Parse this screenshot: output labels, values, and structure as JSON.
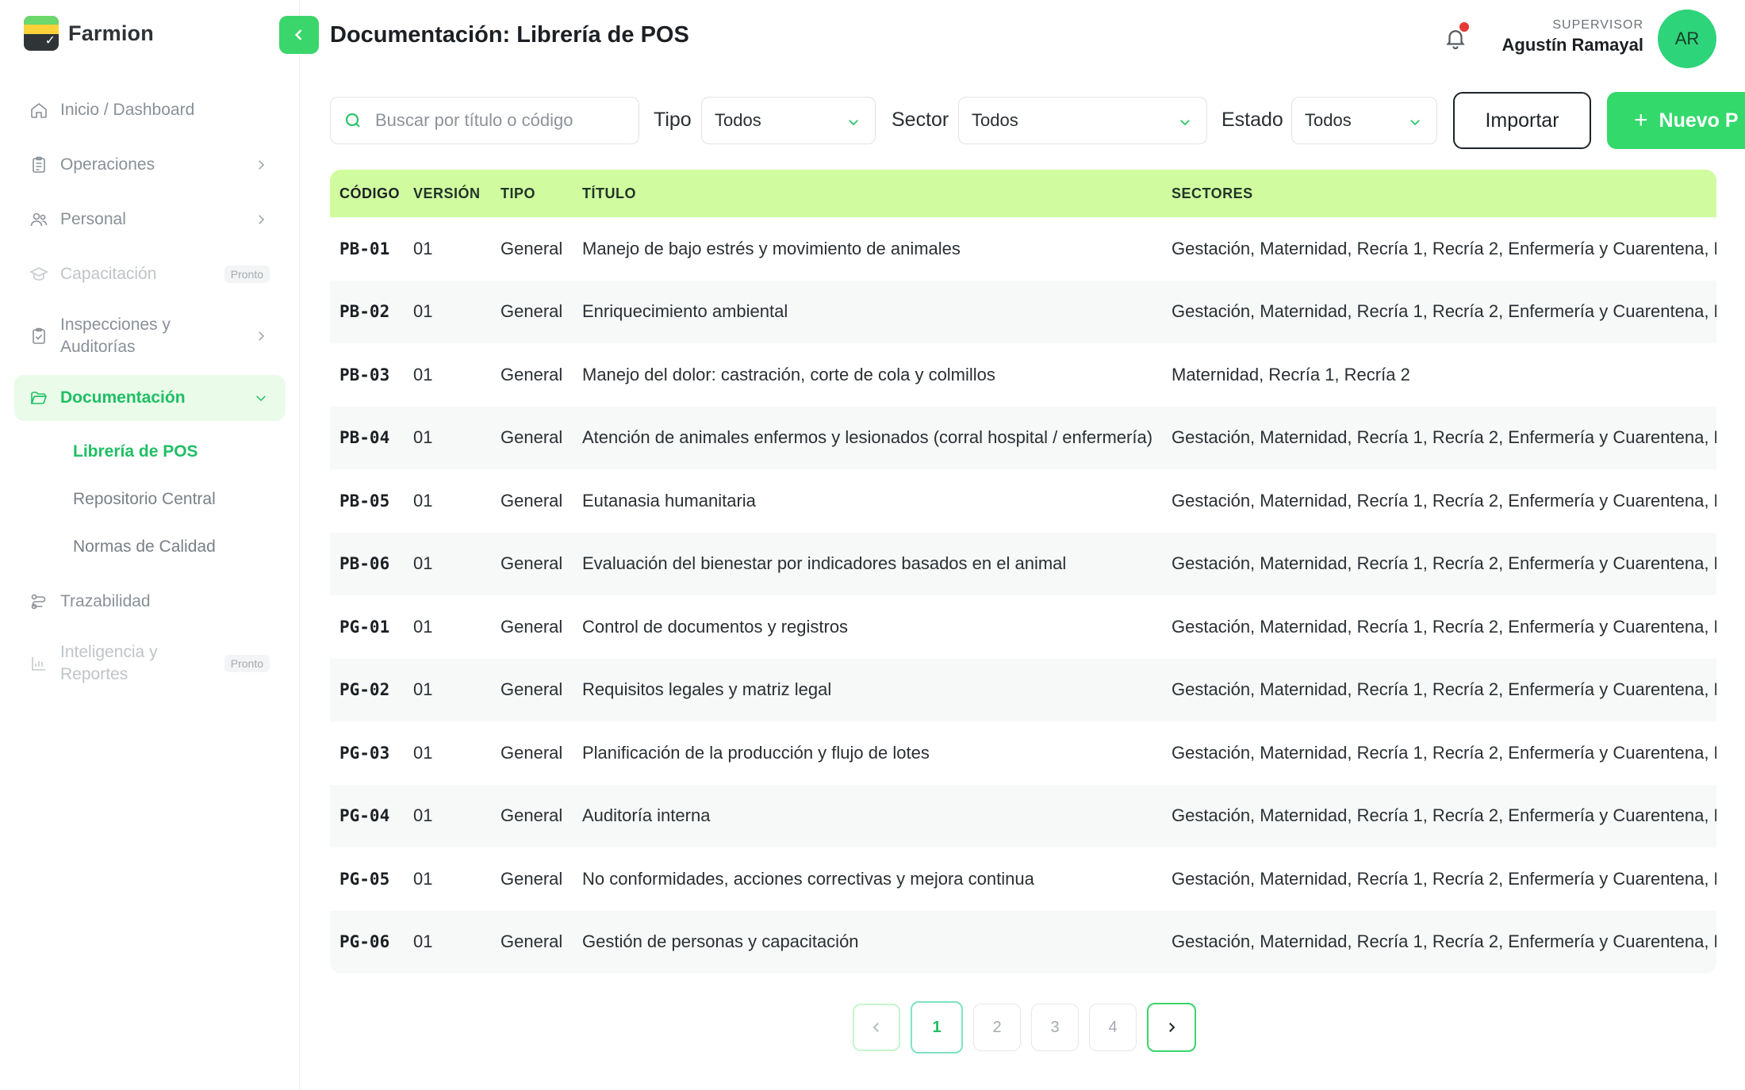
{
  "brand": {
    "name": "Farmion"
  },
  "header": {
    "title": "Documentación: Librería de POS",
    "user_role": "SUPERVISOR",
    "user_name": "Agustín Ramayal",
    "avatar_initials": "AR"
  },
  "sidebar": {
    "items": [
      {
        "label": "Inicio / Dashboard",
        "icon": "home-icon"
      },
      {
        "label": "Operaciones",
        "icon": "clipboard-icon"
      },
      {
        "label": "Personal",
        "icon": "users-icon"
      },
      {
        "label": "Capacitación",
        "icon": "graduation-cap-icon",
        "badge": "Pronto"
      },
      {
        "label": "Inspecciones y Auditorías",
        "icon": "clipboard-check-icon"
      },
      {
        "label": "Documentación",
        "icon": "folder-open-icon"
      },
      {
        "label": "Trazabilidad",
        "icon": "route-icon"
      },
      {
        "label": "Inteligencia y Reportes",
        "icon": "bar-chart-icon",
        "badge": "Pronto"
      }
    ],
    "subitems": [
      {
        "label": "Librería de POS"
      },
      {
        "label": "Repositorio Central"
      },
      {
        "label": "Normas de Calidad"
      }
    ]
  },
  "toolbar": {
    "search_placeholder": "Buscar por título o código",
    "tipo_label": "Tipo",
    "tipo_value": "Todos",
    "sector_label": "Sector",
    "sector_value": "Todos",
    "estado_label": "Estado",
    "estado_value": "Todos",
    "import_label": "Importar",
    "new_label": "Nuevo P"
  },
  "table": {
    "headers": {
      "code": "CÓDIGO",
      "version": "VERSIÓN",
      "type": "TIPO",
      "title": "TÍTULO",
      "sectors": "SECTORES"
    },
    "rows": [
      {
        "code": "PB-01",
        "version": "01",
        "type": "General",
        "title": "Manejo de bajo estrés y movimiento de animales",
        "sectors": "Gestación, Maternidad, Recría 1, Recría 2, Enfermería y Cuarentena, En"
      },
      {
        "code": "PB-02",
        "version": "01",
        "type": "General",
        "title": "Enriquecimiento ambiental",
        "sectors": "Gestación, Maternidad, Recría 1, Recría 2, Enfermería y Cuarentena, En"
      },
      {
        "code": "PB-03",
        "version": "01",
        "type": "General",
        "title": "Manejo del dolor: castración, corte de cola y colmillos",
        "sectors": "Maternidad, Recría 1, Recría 2"
      },
      {
        "code": "PB-04",
        "version": "01",
        "type": "General",
        "title": "Atención de animales enfermos y lesionados (corral hospital / enfermería)",
        "sectors": "Gestación, Maternidad, Recría 1, Recría 2, Enfermería y Cuarentena, En"
      },
      {
        "code": "PB-05",
        "version": "01",
        "type": "General",
        "title": "Eutanasia humanitaria",
        "sectors": "Gestación, Maternidad, Recría 1, Recría 2, Enfermería y Cuarentena, En"
      },
      {
        "code": "PB-06",
        "version": "01",
        "type": "General",
        "title": "Evaluación del bienestar por indicadores basados en el animal",
        "sectors": "Gestación, Maternidad, Recría 1, Recría 2, Enfermería y Cuarentena, En"
      },
      {
        "code": "PG-01",
        "version": "01",
        "type": "General",
        "title": "Control de documentos y registros",
        "sectors": "Gestación, Maternidad, Recría 1, Recría 2, Enfermería y Cuarentena, En"
      },
      {
        "code": "PG-02",
        "version": "01",
        "type": "General",
        "title": "Requisitos legales y matriz legal",
        "sectors": "Gestación, Maternidad, Recría 1, Recría 2, Enfermería y Cuarentena, En"
      },
      {
        "code": "PG-03",
        "version": "01",
        "type": "General",
        "title": "Planificación de la producción y flujo de lotes",
        "sectors": "Gestación, Maternidad, Recría 1, Recría 2, Enfermería y Cuarentena, En"
      },
      {
        "code": "PG-04",
        "version": "01",
        "type": "General",
        "title": "Auditoría interna",
        "sectors": "Gestación, Maternidad, Recría 1, Recría 2, Enfermería y Cuarentena, En"
      },
      {
        "code": "PG-05",
        "version": "01",
        "type": "General",
        "title": "No conformidades, acciones correctivas y mejora continua",
        "sectors": "Gestación, Maternidad, Recría 1, Recría 2, Enfermería y Cuarentena, En"
      },
      {
        "code": "PG-06",
        "version": "01",
        "type": "General",
        "title": "Gestión de personas y capacitación",
        "sectors": "Gestación, Maternidad, Recría 1, Recría 2, Enfermería y Cuarentena, En"
      }
    ]
  },
  "pagination": {
    "pages": [
      "1",
      "2",
      "3",
      "4"
    ],
    "current": "1"
  },
  "colors": {
    "accent": "#33d96b",
    "accent_text": "#1fbf64",
    "table_header": "#d0fc9f",
    "active_nav_bg": "#eafbea",
    "notification_dot": "#e53935"
  }
}
